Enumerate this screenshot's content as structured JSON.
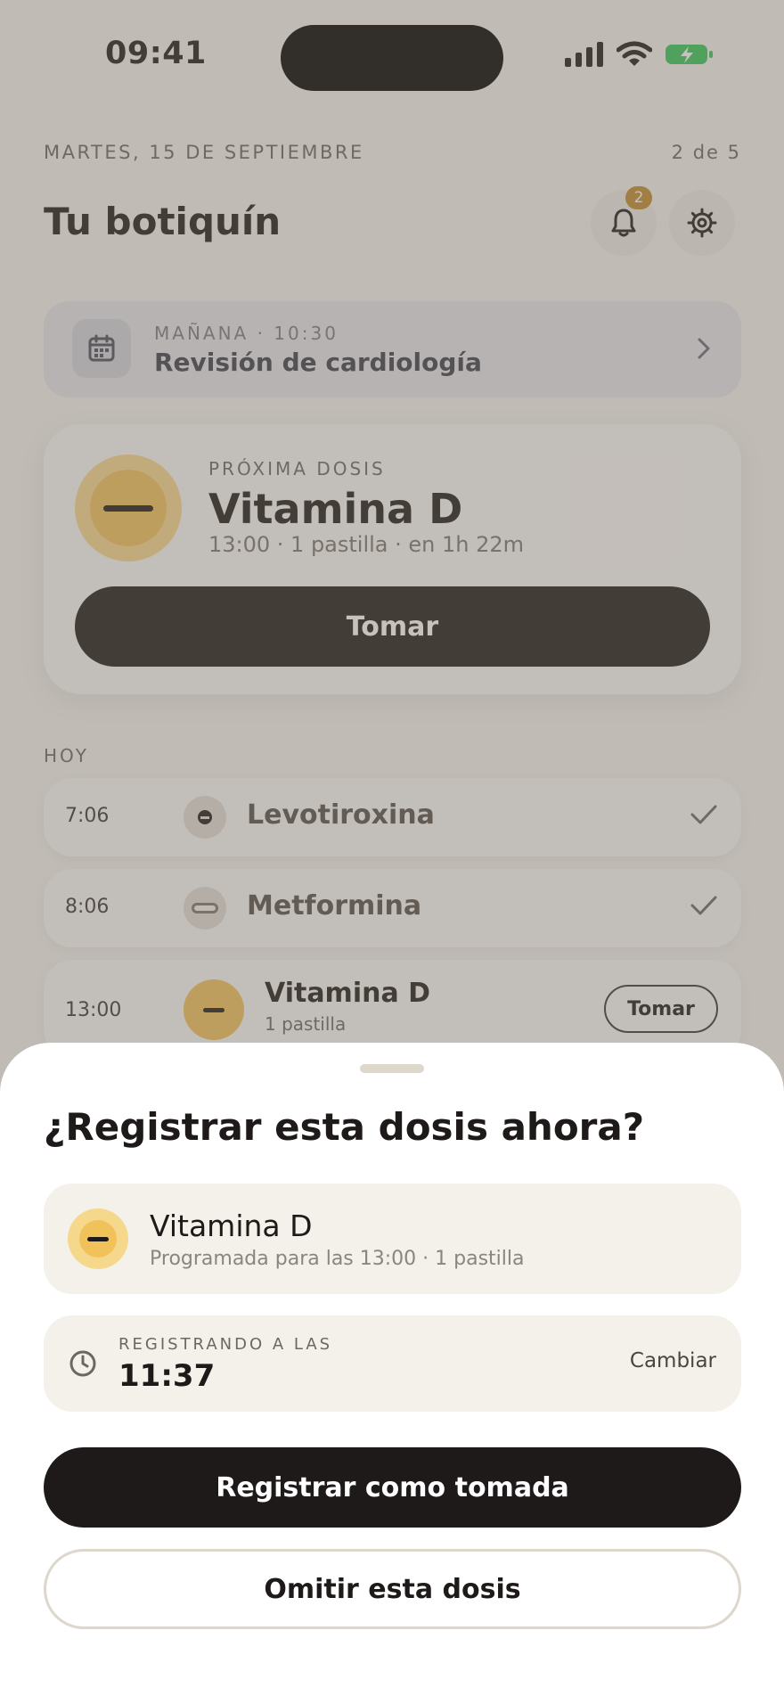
{
  "status_bar": {
    "time": "09:41"
  },
  "header": {
    "date": "MARTES, 15 DE SEPTIEMBRE",
    "page_count": "2 de 5",
    "title": "Tu botiquín",
    "notification_count": "2"
  },
  "appointment": {
    "meta": "MAÑANA · 10:30",
    "title": "Revisión de cardiología"
  },
  "next_dose": {
    "label": "PRÓXIMA DOSIS",
    "name": "Vitamina D",
    "details": "13:00 · 1 pastilla · en 1h 22m",
    "take_label": "Tomar",
    "pill_color": "#f2c25a"
  },
  "today": {
    "label": "HOY",
    "items": [
      {
        "time": "7:06",
        "name": "Levotiroxina",
        "status": "taken"
      },
      {
        "time": "8:06",
        "name": "Metformina",
        "status": "taken"
      },
      {
        "time": "13:00",
        "name": "Vitamina D",
        "sub": "1 pastilla",
        "action_label": "Tomar"
      }
    ]
  },
  "sheet": {
    "title": "¿Registrar esta dosis ahora?",
    "medication": {
      "name": "Vitamina D",
      "schedule": "Programada para las 13:00 · 1 pastilla"
    },
    "registering": {
      "label": "REGISTRANDO A LAS",
      "time": "11:37",
      "change_label": "Cambiar"
    },
    "primary_label": "Registrar como tomada",
    "secondary_label": "Omitir esta dosis"
  },
  "colors": {
    "ink": "#1e1a19",
    "accent_yellow": "#f2c25a",
    "badge": "#c08a2e",
    "status_green": "#34c759"
  }
}
